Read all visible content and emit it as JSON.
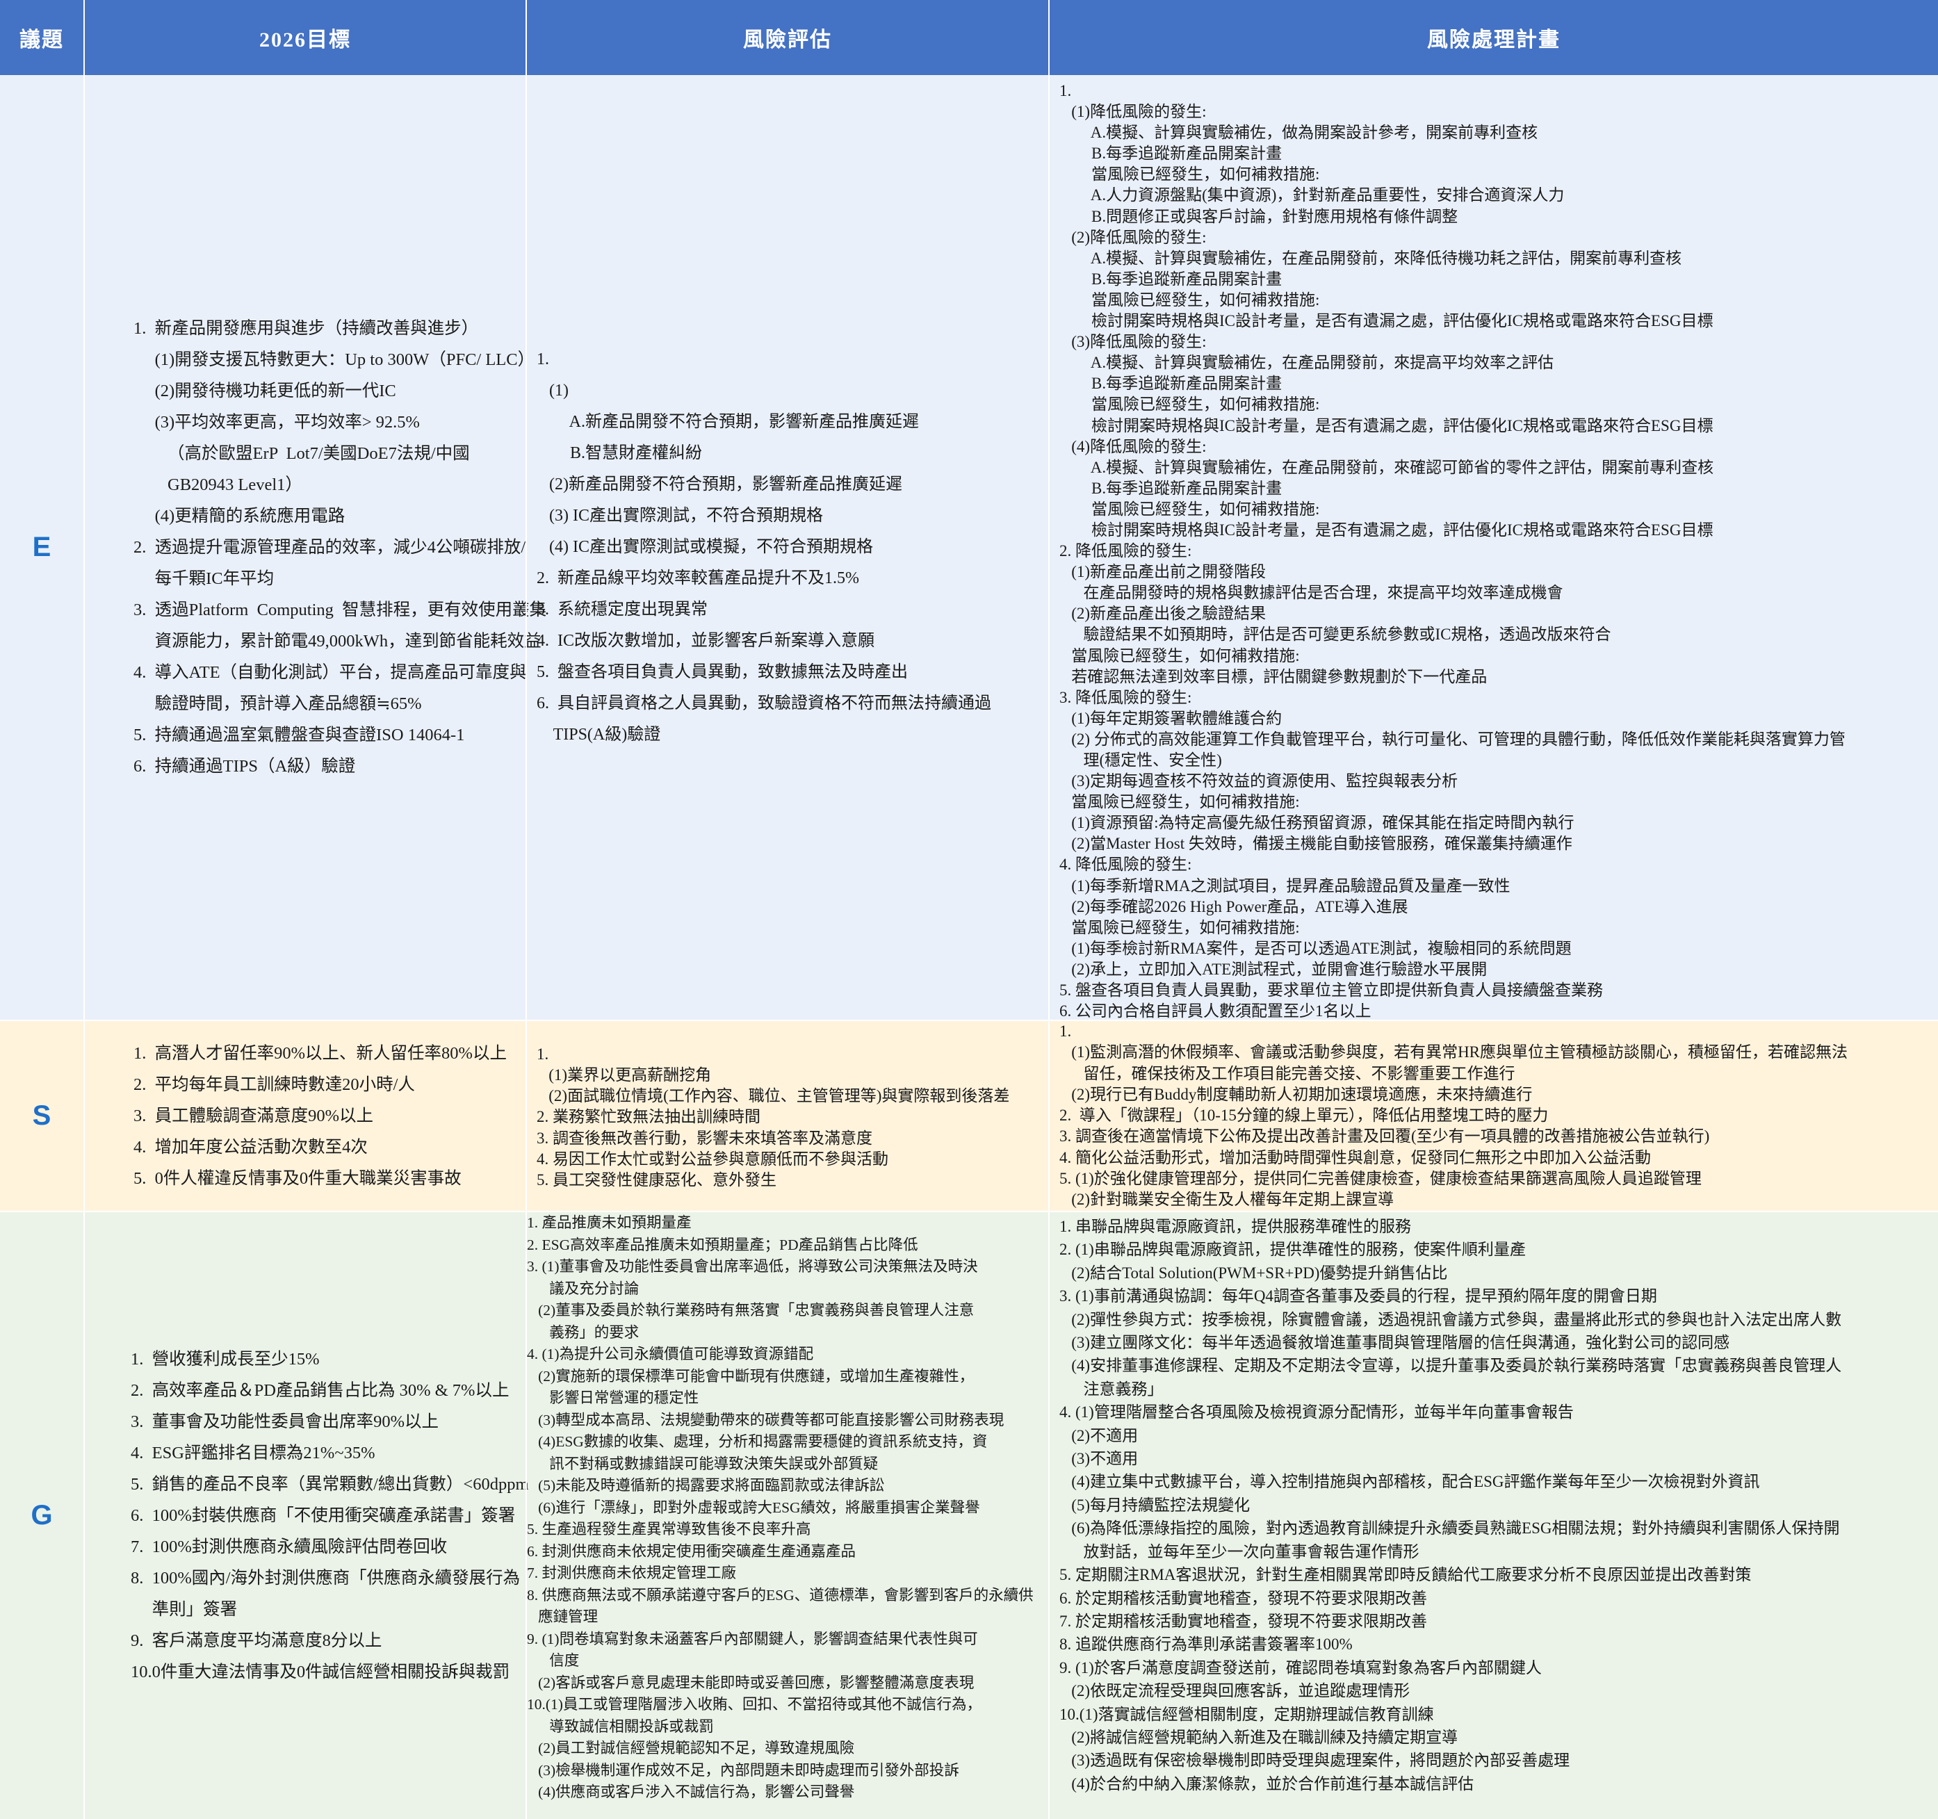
{
  "header": {
    "topic": "議題",
    "target": "2026目標",
    "risk": "風險評估",
    "plan": "風險處理計畫"
  },
  "rows": [
    {
      "topic": "E",
      "targets": [
        "1.  新產品開發應用與進步（持續改善與進步）",
        "     (1)開發支援瓦特數更大：Up to 300W（PFC/ LLC）",
        "     (2)開發待機功耗更低的新一代IC",
        "     (3)平均效率更高，平均效率> 92.5%",
        "        （高於歐盟ErP  Lot7/美國DoE7法規/中國",
        "        GB20943 Level1）",
        "     (4)更精簡的系統應用電路",
        "2.  透過提升電源管理產品的效率，減少4公噸碳排放/",
        "     每千顆IC年平均",
        "3.  透過Platform  Computing  智慧排程，更有效使用叢集",
        "     資源能力，累計節電49,000kWh，達到節省能耗效益",
        "4.  導入ATE（自動化測試）平台，提高產品可靠度與",
        "     驗證時間，預計導入產品總額≒65%",
        "5.  持續通過溫室氣體盤查與查證ISO 14064-1",
        "6.  持續通過TIPS（A級）驗證"
      ],
      "risks": [
        "1.",
        "   (1)",
        "        A.新產品開發不符合預期，影響新產品推廣延遲",
        "        B.智慧財產權糾紛",
        "   (2)新產品開發不符合預期，影響新產品推廣延遲",
        "   (3) IC產出實際測試，不符合預期規格",
        "   (4) IC產出實際測試或模擬，不符合預期規格",
        "2.  新產品線平均效率較舊產品提升不及1.5%",
        "3.  系統穩定度出現異常",
        "4.  IC改版次數增加，並影響客戶新案導入意願",
        "5.  盤查各項目負責人員異動，致數據無法及時產出",
        "6.  具自評員資格之人員異動，致驗證資格不符而無法持續通過",
        "    TIPS(A級)驗證"
      ],
      "plans": [
        "1.",
        "   (1)降低風險的發生:",
        "        A.模擬、計算與實驗補佐，做為開案設計參考，開案前專利查核",
        "        B.每季追蹤新產品開案計畫",
        "        當風險已經發生，如何補救措施:",
        "        A.人力資源盤點(集中資源)，針對新產品重要性，安排合適資深人力",
        "        B.問題修正或與客戶討論，針對應用規格有條件調整",
        "   (2)降低風險的發生:",
        "        A.模擬、計算與實驗補佐，在產品開發前，來降低待機功耗之評估，開案前專利查核",
        "        B.每季追蹤新產品開案計畫",
        "        當風險已經發生，如何補救措施:",
        "        檢討開案時規格與IC設計考量，是否有遺漏之處，評估優化IC規格或電路來符合ESG目標",
        "   (3)降低風險的發生:",
        "        A.模擬、計算與實驗補佐，在產品開發前，來提高平均效率之評估",
        "        B.每季追蹤新產品開案計畫",
        "        當風險已經發生，如何補救措施:",
        "        檢討開案時規格與IC設計考量，是否有遺漏之處，評估優化IC規格或電路來符合ESG目標",
        "   (4)降低風險的發生:",
        "        A.模擬、計算與實驗補佐，在產品開發前，來確認可節省的零件之評估，開案前專利查核",
        "        B.每季追蹤新產品開案計畫",
        "        當風險已經發生，如何補救措施:",
        "        檢討開案時規格與IC設計考量，是否有遺漏之處，評估優化IC規格或電路來符合ESG目標",
        "2. 降低風險的發生:",
        "   (1)新產品產出前之開發階段",
        "      在產品開發時的規格與數據評估是否合理，來提高平均效率達成機會",
        "   (2)新產品產出後之驗證結果",
        "      驗證結果不如預期時，評估是否可變更系統參數或IC規格，透過改版來符合",
        "   當風險已經發生，如何補救措施:",
        "   若確認無法達到效率目標，評估關鍵參數規劃於下一代產品",
        "3. 降低風險的發生:",
        "   (1)每年定期簽署軟體維護合約",
        "   (2) 分佈式的高效能運算工作負載管理平台，執行可量化、可管理的具體行動，降低低效作業能耗與落實算力管",
        "      理(穩定性、安全性)",
        "   (3)定期每週查核不符效益的資源使用、監控與報表分析",
        "   當風險已經發生，如何補救措施:",
        "   (1)資源預留:為特定高優先級任務預留資源，確保其能在指定時間內執行",
        "   (2)當Master Host 失效時，備援主機能自動接管服務，確保叢集持續運作",
        "4. 降低風險的發生:",
        "   (1)每季新增RMA之測試項目，提昇產品驗證品質及量產一致性",
        "   (2)每季確認2026 High Power產品，ATE導入進展",
        "   當風險已經發生，如何補救措施:",
        "   (1)每季檢討新RMA案件，是否可以透過ATE測試，複驗相同的系統問題",
        "   (2)承上，立即加入ATE測試程式，並開會進行驗證水平展開",
        "5. 盤查各項目負責人員異動，要求單位主管立即提供新負責人員接續盤查業務",
        "6. 公司內合格自評員人數須配置至少1名以上"
      ]
    },
    {
      "topic": "S",
      "targets": [
        "1.  高潛人才留任率90%以上、新人留任率80%以上",
        "2.  平均每年員工訓練時數達20小時/人",
        "3.  員工體驗調查滿意度90%以上",
        "4.  增加年度公益活動次數至4次",
        "5.  0件人權違反情事及0件重大職業災害事故"
      ],
      "risks": [
        "1.",
        "   (1)業界以更高薪酬挖角",
        "   (2)面試職位情境(工作內容、職位、主管管理等)與實際報到後落差",
        "2. 業務繁忙致無法抽出訓練時間",
        "3. 調查後無改善行動，影響未來填答率及滿意度",
        "4. 易因工作太忙或對公益參與意願低而不參與活動",
        "5. 員工突發性健康惡化、意外發生"
      ],
      "plans": [
        "1.",
        "   (1)監測高潛的休假頻率、會議或活動參與度，若有異常HR應與單位主管積極訪談關心，積極留任，若確認無法",
        "      留任，確保技術及工作項目能完善交接、不影響重要工作進行",
        "   (2)現行已有Buddy制度輔助新人初期加速環境適應，未來持續進行",
        "2.  導入「微課程」（10-15分鐘的線上單元），降低佔用整塊工時的壓力",
        "3. 調查後在適當情境下公佈及提出改善計畫及回覆(至少有一項具體的改善措施被公告並執行)",
        "4. 簡化公益活動形式，增加活動時間彈性與創意，促發同仁無形之中即加入公益活動",
        "5. (1)於強化健康管理部分，提供同仁完善健康檢查，健康檢查結果篩選高風險人員追蹤管理",
        "   (2)針對職業安全衛生及人權每年定期上課宣導"
      ]
    },
    {
      "topic": "G",
      "targets": [
        "1.  營收獲利成長至少15%",
        "2.  高效率產品＆PD產品銷售占比為 30% & 7%以上",
        "3.  董事會及功能性委員會出席率90%以上",
        "4.  ESG評鑑排名目標為21%~35%",
        "5.  銷售的產品不良率（異常顆數/總出貨數）<60dppm",
        "6.  100%封裝供應商「不使用衝突礦產承諾書」簽署",
        "7.  100%封測供應商永續風險評估問卷回收",
        "8.  100%國內/海外封測供應商「供應商永續發展行為",
        "     準則」簽署",
        "9.  客戶滿意度平均滿意度8分以上",
        "10.0件重大違法情事及0件誠信經營相關投訴與裁罰"
      ],
      "risks": [
        "1. 產品推廣未如預期量產",
        "2. ESG高效率產品推廣未如預期量產；PD產品銷售占比降低",
        "3. (1)董事會及功能性委員會出席率過低，將導致公司決策無法及時決",
        "      議及充分討論",
        "   (2)董事及委員於執行業務時有無落實「忠實義務與善良管理人注意",
        "      義務」的要求",
        "4. (1)為提升公司永續價值可能導致資源錯配",
        "   (2)實施新的環保標準可能會中斷現有供應鏈，或增加生產複雜性，",
        "      影響日常營運的穩定性",
        "   (3)轉型成本高昂、法規變動帶來的碳費等都可能直接影響公司財務表現",
        "   (4)ESG數據的收集、處理，分析和揭露需要穩健的資訊系統支持，資",
        "      訊不對稱或數據錯誤可能導致決策失誤或外部質疑",
        "   (5)未能及時遵循新的揭露要求將面臨罰款或法律訴訟",
        "   (6)進行「漂綠」，即對外虛報或誇大ESG績效，將嚴重損害企業聲譽",
        "5. 生產過程發生產異常導致售後不良率升高",
        "6. 封測供應商未依規定使用衝突礦產生產通嘉產品",
        "7. 封測供應商未依規定管理工廠",
        "8. 供應商無法或不願承諾遵守客戶的ESG、道德標準，會影響到客戶的永續供",
        "   應鏈管理",
        "9. (1)問卷填寫對象未涵蓋客戶內部關鍵人，影響調查結果代表性與可",
        "      信度",
        "   (2)客訴或客戶意見處理未能即時或妥善回應，影響整體滿意度表現",
        "10.(1)員工或管理階層涉入收賄、回扣、不當招待或其他不誠信行為，",
        "      導致誠信相關投訴或裁罰",
        "   (2)員工對誠信經營規範認知不足，導致違規風險",
        "   (3)檢舉機制運作成效不足，內部問題未即時處理而引發外部投訴",
        "   (4)供應商或客戶涉入不誠信行為，影響公司聲譽"
      ],
      "plans": [
        "1. 串聯品牌與電源廠資訊，提供服務準確性的服務",
        "2. (1)串聯品牌與電源廠資訊，提供準確性的服務，使案件順利量產",
        "   (2)結合Total Solution(PWM+SR+PD)優勢提升銷售佔比",
        "3. (1)事前溝通與協調：每年Q4調查各董事及委員的行程，提早預約隔年度的開會日期",
        "   (2)彈性參與方式：按季檢視，除實體會議，透過視訊會議方式參與，盡量將此形式的參與也計入法定出席人數",
        "   (3)建立團隊文化：每半年透過餐敘增進董事間與管理階層的信任與溝通，強化對公司的認同感",
        "   (4)安排董事進修課程、定期及不定期法令宣導，以提升董事及委員於執行業務時落實「忠實義務與善良管理人",
        "      注意義務」",
        "4. (1)管理階層整合各項風險及檢視資源分配情形，並每半年向董事會報告",
        "   (2)不適用",
        "   (3)不適用",
        "   (4)建立集中式數據平台，導入控制措施與內部稽核，配合ESG評鑑作業每年至少一次檢視對外資訊",
        "   (5)每月持續監控法規變化",
        "   (6)為降低漂綠指控的風險，對內透過教育訓練提升永續委員熟識ESG相關法規；對外持續與利害關係人保持開",
        "      放對話，並每年至少一次向董事會報告運作情形",
        "5. 定期關注RMA客退狀況，針對生產相關異常即時反饋給代工廠要求分析不良原因並提出改善對策",
        "6. 於定期稽核活動實地稽查，發現不符要求限期改善",
        "7. 於定期稽核活動實地稽查，發現不符要求限期改善",
        "8. 追蹤供應商行為準則承諾書簽署率100%",
        "9. (1)於客戶滿意度調查發送前，確認問卷填寫對象為客戶內部關鍵人",
        "   (2)依既定流程受理與回應客訴，並追蹤處理情形",
        "10.(1)落實誠信經營相關制度，定期辦理誠信教育訓練",
        "   (2)將誠信經營規範納入新進及在職訓練及持續定期宣導",
        "   (3)透過既有保密檢舉機制即時受理與處理案件，將問題於內部妥善處理",
        "   (4)於合約中納入廉潔條款，並於合作前進行基本誠信評估"
      ]
    }
  ],
  "colors": {
    "header_bg": "#4472c4",
    "header_text": "#ffffff",
    "topic_text": "#1f6fc8",
    "row_e_bg": "#eaf0f9",
    "row_s_bg": "#fff3dc",
    "row_g_bg": "#ebf3e9"
  }
}
